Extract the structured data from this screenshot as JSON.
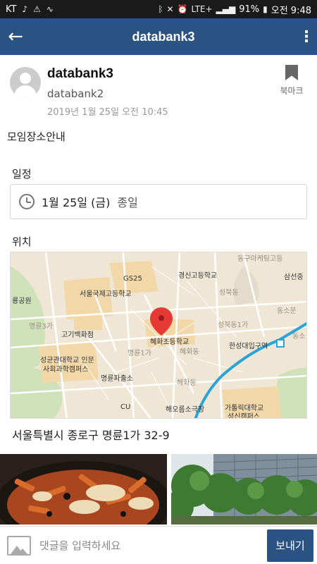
{
  "status_bar": {
    "carrier": "KT",
    "network": "LTE+",
    "battery": "91%",
    "time": "오전 9:48"
  },
  "app_bar": {
    "title": "databank3"
  },
  "post": {
    "author_name": "databank3",
    "author_id": "databank2",
    "timestamp": "2019년 1월 25일 오전 10:45",
    "bookmark_label": "북마크",
    "body": "모임장소안내"
  },
  "schedule": {
    "label": "일정",
    "date": "1월 25일 (금)",
    "all_day": "종일"
  },
  "location": {
    "label": "위치",
    "address": "서울특별시 종로구 명륜1가 32-9",
    "map_labels": {
      "top_right": "동구마케팅고등",
      "gs25": "GS25",
      "kyungshin": "경신고등학교",
      "seongbuk": "성북동",
      "samseon": "삼선중",
      "seoul_intl": "서울국제고등학교",
      "park": "룡공원",
      "dongso": "동소문",
      "myeongnyun3": "명륜3가",
      "seongbuk1": "성북동1가",
      "dongso2": "동소",
      "hyehwa_elem": "혜화초등학교",
      "gogi": "고기백화점",
      "hansung": "한성대입구역",
      "hyehwadong": "혜화동",
      "myeongnyun1": "명륜1가",
      "skku1": "성균관대학교 인문",
      "skku2": "사회과학캠퍼스",
      "myeongnyun_pajeon": "명륜파출소",
      "hyehwadong2": "혜화동",
      "cu": "CU",
      "hyehwa_theater": "해오름소극장",
      "catholic1": "가톨릭대학교",
      "catholic2": "성신캠퍼스"
    }
  },
  "comment": {
    "placeholder": "댓글을 입력하세요",
    "send_label": "보내기"
  }
}
